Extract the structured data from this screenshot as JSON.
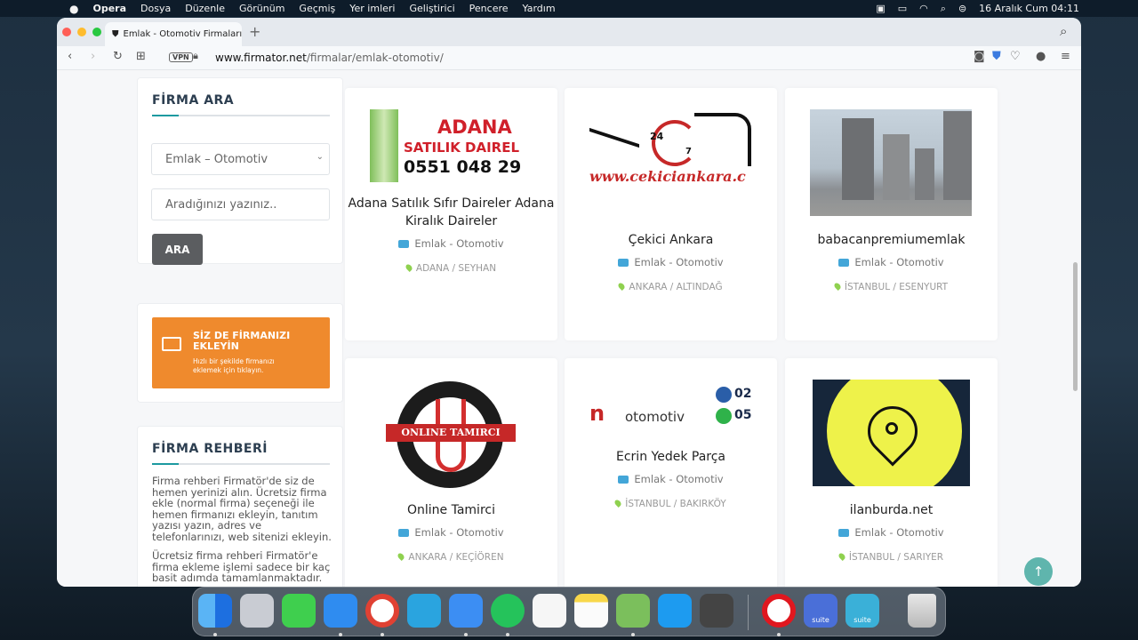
{
  "menubar": {
    "app": "Opera",
    "items": [
      "Dosya",
      "Düzenle",
      "Görünüm",
      "Geçmiş",
      "Yer imleri",
      "Geliştirici",
      "Pencere",
      "Yardım"
    ],
    "clock": "16 Aralık Cum  04:11"
  },
  "browser": {
    "tab_title": "Emlak - Otomotiv Firmaları Kate",
    "vpn": "VPN",
    "url_host": "www.firmator.net",
    "url_path": "/firmalar/emlak-otomotiv/"
  },
  "sidebar": {
    "search_title": "FİRMA ARA",
    "category_selected": "Emlak – Otomotiv",
    "search_placeholder": "Aradığınızı yazınız..",
    "search_button": "ARA",
    "add_title": "SİZ DE FİRMANIZI EKLEYİN",
    "add_sub": "Hızlı bir şekilde firmanızı eklemek için tıklayın.",
    "guide_title": "FİRMA REHBERİ",
    "guide_p1": "Firma rehberi Firmatör'de siz de hemen yerinizi alın. Ücretsiz firma ekle (normal firma) seçeneği ile hemen firmanızı ekleyin, tanıtım yazısı yazın, adres ve telefonlarınızı, web sitenizi ekleyin.",
    "guide_p2": "Ücretsiz firma rehberi Firmatör'e firma ekleme işlemi sadece bir kaç basit adımda tamamlanmaktadır."
  },
  "firms": [
    {
      "name": "Adana Satılık Sıfır Daireler Adana Kiralık Daireler",
      "category": "Emlak - Otomotiv",
      "location": "ADANA / SEYHAN",
      "logo_text1": "ADANA",
      "logo_text2": "SATILIK DAIREL",
      "logo_text3": "0551 048 29"
    },
    {
      "name": "Çekici Ankara",
      "category": "Emlak - Otomotiv",
      "location": "ANKARA / ALTINDAĞ",
      "logo_text1": "www.cekiciankara.c",
      "logo_text2": "24",
      "logo_text3": "7"
    },
    {
      "name": "babacanpremiumemlak",
      "category": "Emlak - Otomotiv",
      "location": "İSTANBUL / ESENYURT"
    },
    {
      "name": "Online Tamirci",
      "category": "Emlak - Otomotiv",
      "location": "ANKARA / KEÇİÖREN",
      "logo_text1": "ONLINE TAMIRCI"
    },
    {
      "name": "Ecrin Yedek Parça",
      "category": "Emlak - Otomotiv",
      "location": "İSTANBUL / BAKIRKÖY",
      "logo_text1": "otomotiv",
      "logo_text2": "02",
      "logo_text3": "05"
    },
    {
      "name": "ilanburda.net",
      "category": "Emlak - Otomotiv",
      "location": "İSTANBUL / SARIYER"
    }
  ],
  "dock": {
    "suite_label": "suite"
  }
}
